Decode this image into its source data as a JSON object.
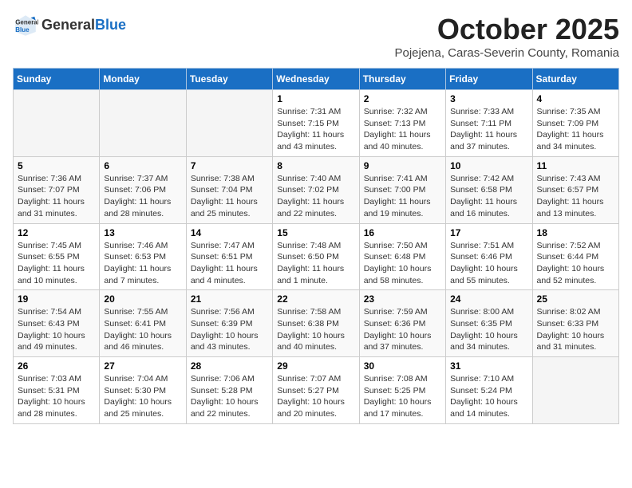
{
  "header": {
    "logo_general": "General",
    "logo_blue": "Blue",
    "month": "October 2025",
    "location": "Pojejena, Caras-Severin County, Romania"
  },
  "weekdays": [
    "Sunday",
    "Monday",
    "Tuesday",
    "Wednesday",
    "Thursday",
    "Friday",
    "Saturday"
  ],
  "weeks": [
    [
      {
        "day": "",
        "info": ""
      },
      {
        "day": "",
        "info": ""
      },
      {
        "day": "",
        "info": ""
      },
      {
        "day": "1",
        "info": "Sunrise: 7:31 AM\nSunset: 7:15 PM\nDaylight: 11 hours\nand 43 minutes."
      },
      {
        "day": "2",
        "info": "Sunrise: 7:32 AM\nSunset: 7:13 PM\nDaylight: 11 hours\nand 40 minutes."
      },
      {
        "day": "3",
        "info": "Sunrise: 7:33 AM\nSunset: 7:11 PM\nDaylight: 11 hours\nand 37 minutes."
      },
      {
        "day": "4",
        "info": "Sunrise: 7:35 AM\nSunset: 7:09 PM\nDaylight: 11 hours\nand 34 minutes."
      }
    ],
    [
      {
        "day": "5",
        "info": "Sunrise: 7:36 AM\nSunset: 7:07 PM\nDaylight: 11 hours\nand 31 minutes."
      },
      {
        "day": "6",
        "info": "Sunrise: 7:37 AM\nSunset: 7:06 PM\nDaylight: 11 hours\nand 28 minutes."
      },
      {
        "day": "7",
        "info": "Sunrise: 7:38 AM\nSunset: 7:04 PM\nDaylight: 11 hours\nand 25 minutes."
      },
      {
        "day": "8",
        "info": "Sunrise: 7:40 AM\nSunset: 7:02 PM\nDaylight: 11 hours\nand 22 minutes."
      },
      {
        "day": "9",
        "info": "Sunrise: 7:41 AM\nSunset: 7:00 PM\nDaylight: 11 hours\nand 19 minutes."
      },
      {
        "day": "10",
        "info": "Sunrise: 7:42 AM\nSunset: 6:58 PM\nDaylight: 11 hours\nand 16 minutes."
      },
      {
        "day": "11",
        "info": "Sunrise: 7:43 AM\nSunset: 6:57 PM\nDaylight: 11 hours\nand 13 minutes."
      }
    ],
    [
      {
        "day": "12",
        "info": "Sunrise: 7:45 AM\nSunset: 6:55 PM\nDaylight: 11 hours\nand 10 minutes."
      },
      {
        "day": "13",
        "info": "Sunrise: 7:46 AM\nSunset: 6:53 PM\nDaylight: 11 hours\nand 7 minutes."
      },
      {
        "day": "14",
        "info": "Sunrise: 7:47 AM\nSunset: 6:51 PM\nDaylight: 11 hours\nand 4 minutes."
      },
      {
        "day": "15",
        "info": "Sunrise: 7:48 AM\nSunset: 6:50 PM\nDaylight: 11 hours\nand 1 minute."
      },
      {
        "day": "16",
        "info": "Sunrise: 7:50 AM\nSunset: 6:48 PM\nDaylight: 10 hours\nand 58 minutes."
      },
      {
        "day": "17",
        "info": "Sunrise: 7:51 AM\nSunset: 6:46 PM\nDaylight: 10 hours\nand 55 minutes."
      },
      {
        "day": "18",
        "info": "Sunrise: 7:52 AM\nSunset: 6:44 PM\nDaylight: 10 hours\nand 52 minutes."
      }
    ],
    [
      {
        "day": "19",
        "info": "Sunrise: 7:54 AM\nSunset: 6:43 PM\nDaylight: 10 hours\nand 49 minutes."
      },
      {
        "day": "20",
        "info": "Sunrise: 7:55 AM\nSunset: 6:41 PM\nDaylight: 10 hours\nand 46 minutes."
      },
      {
        "day": "21",
        "info": "Sunrise: 7:56 AM\nSunset: 6:39 PM\nDaylight: 10 hours\nand 43 minutes."
      },
      {
        "day": "22",
        "info": "Sunrise: 7:58 AM\nSunset: 6:38 PM\nDaylight: 10 hours\nand 40 minutes."
      },
      {
        "day": "23",
        "info": "Sunrise: 7:59 AM\nSunset: 6:36 PM\nDaylight: 10 hours\nand 37 minutes."
      },
      {
        "day": "24",
        "info": "Sunrise: 8:00 AM\nSunset: 6:35 PM\nDaylight: 10 hours\nand 34 minutes."
      },
      {
        "day": "25",
        "info": "Sunrise: 8:02 AM\nSunset: 6:33 PM\nDaylight: 10 hours\nand 31 minutes."
      }
    ],
    [
      {
        "day": "26",
        "info": "Sunrise: 7:03 AM\nSunset: 5:31 PM\nDaylight: 10 hours\nand 28 minutes."
      },
      {
        "day": "27",
        "info": "Sunrise: 7:04 AM\nSunset: 5:30 PM\nDaylight: 10 hours\nand 25 minutes."
      },
      {
        "day": "28",
        "info": "Sunrise: 7:06 AM\nSunset: 5:28 PM\nDaylight: 10 hours\nand 22 minutes."
      },
      {
        "day": "29",
        "info": "Sunrise: 7:07 AM\nSunset: 5:27 PM\nDaylight: 10 hours\nand 20 minutes."
      },
      {
        "day": "30",
        "info": "Sunrise: 7:08 AM\nSunset: 5:25 PM\nDaylight: 10 hours\nand 17 minutes."
      },
      {
        "day": "31",
        "info": "Sunrise: 7:10 AM\nSunset: 5:24 PM\nDaylight: 10 hours\nand 14 minutes."
      },
      {
        "day": "",
        "info": ""
      }
    ]
  ]
}
